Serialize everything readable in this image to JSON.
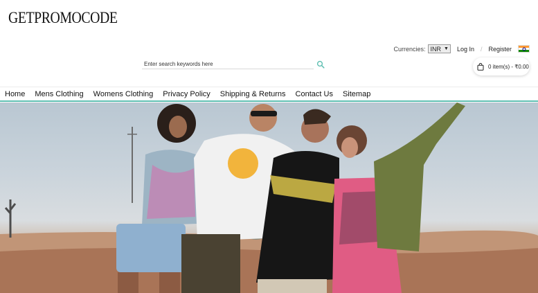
{
  "brand": {
    "logo_text": "GETPROMOCODE"
  },
  "topbar": {
    "currencies_label": "Currencies:",
    "currency_selected": "INR",
    "login_label": "Log In",
    "separator": "/",
    "register_label": "Register",
    "flag_icon": "india-flag-icon"
  },
  "search": {
    "placeholder": "Enter search keywords here",
    "value": "",
    "button_icon": "search-icon",
    "accent_color": "#5fbfb2"
  },
  "cart": {
    "label": "0 item(s) - ₹0.00",
    "icon": "shopping-bag-icon"
  },
  "nav": {
    "items": [
      {
        "label": "Home"
      },
      {
        "label": "Mens Clothing"
      },
      {
        "label": "Womens Clothing"
      },
      {
        "label": "Privacy Policy"
      },
      {
        "label": "Shipping & Returns"
      },
      {
        "label": "Contact Us"
      },
      {
        "label": "Sitemap"
      }
    ],
    "underline_color": "#5fbfb2"
  },
  "hero": {
    "image": "banner-photo-friends-desert"
  }
}
